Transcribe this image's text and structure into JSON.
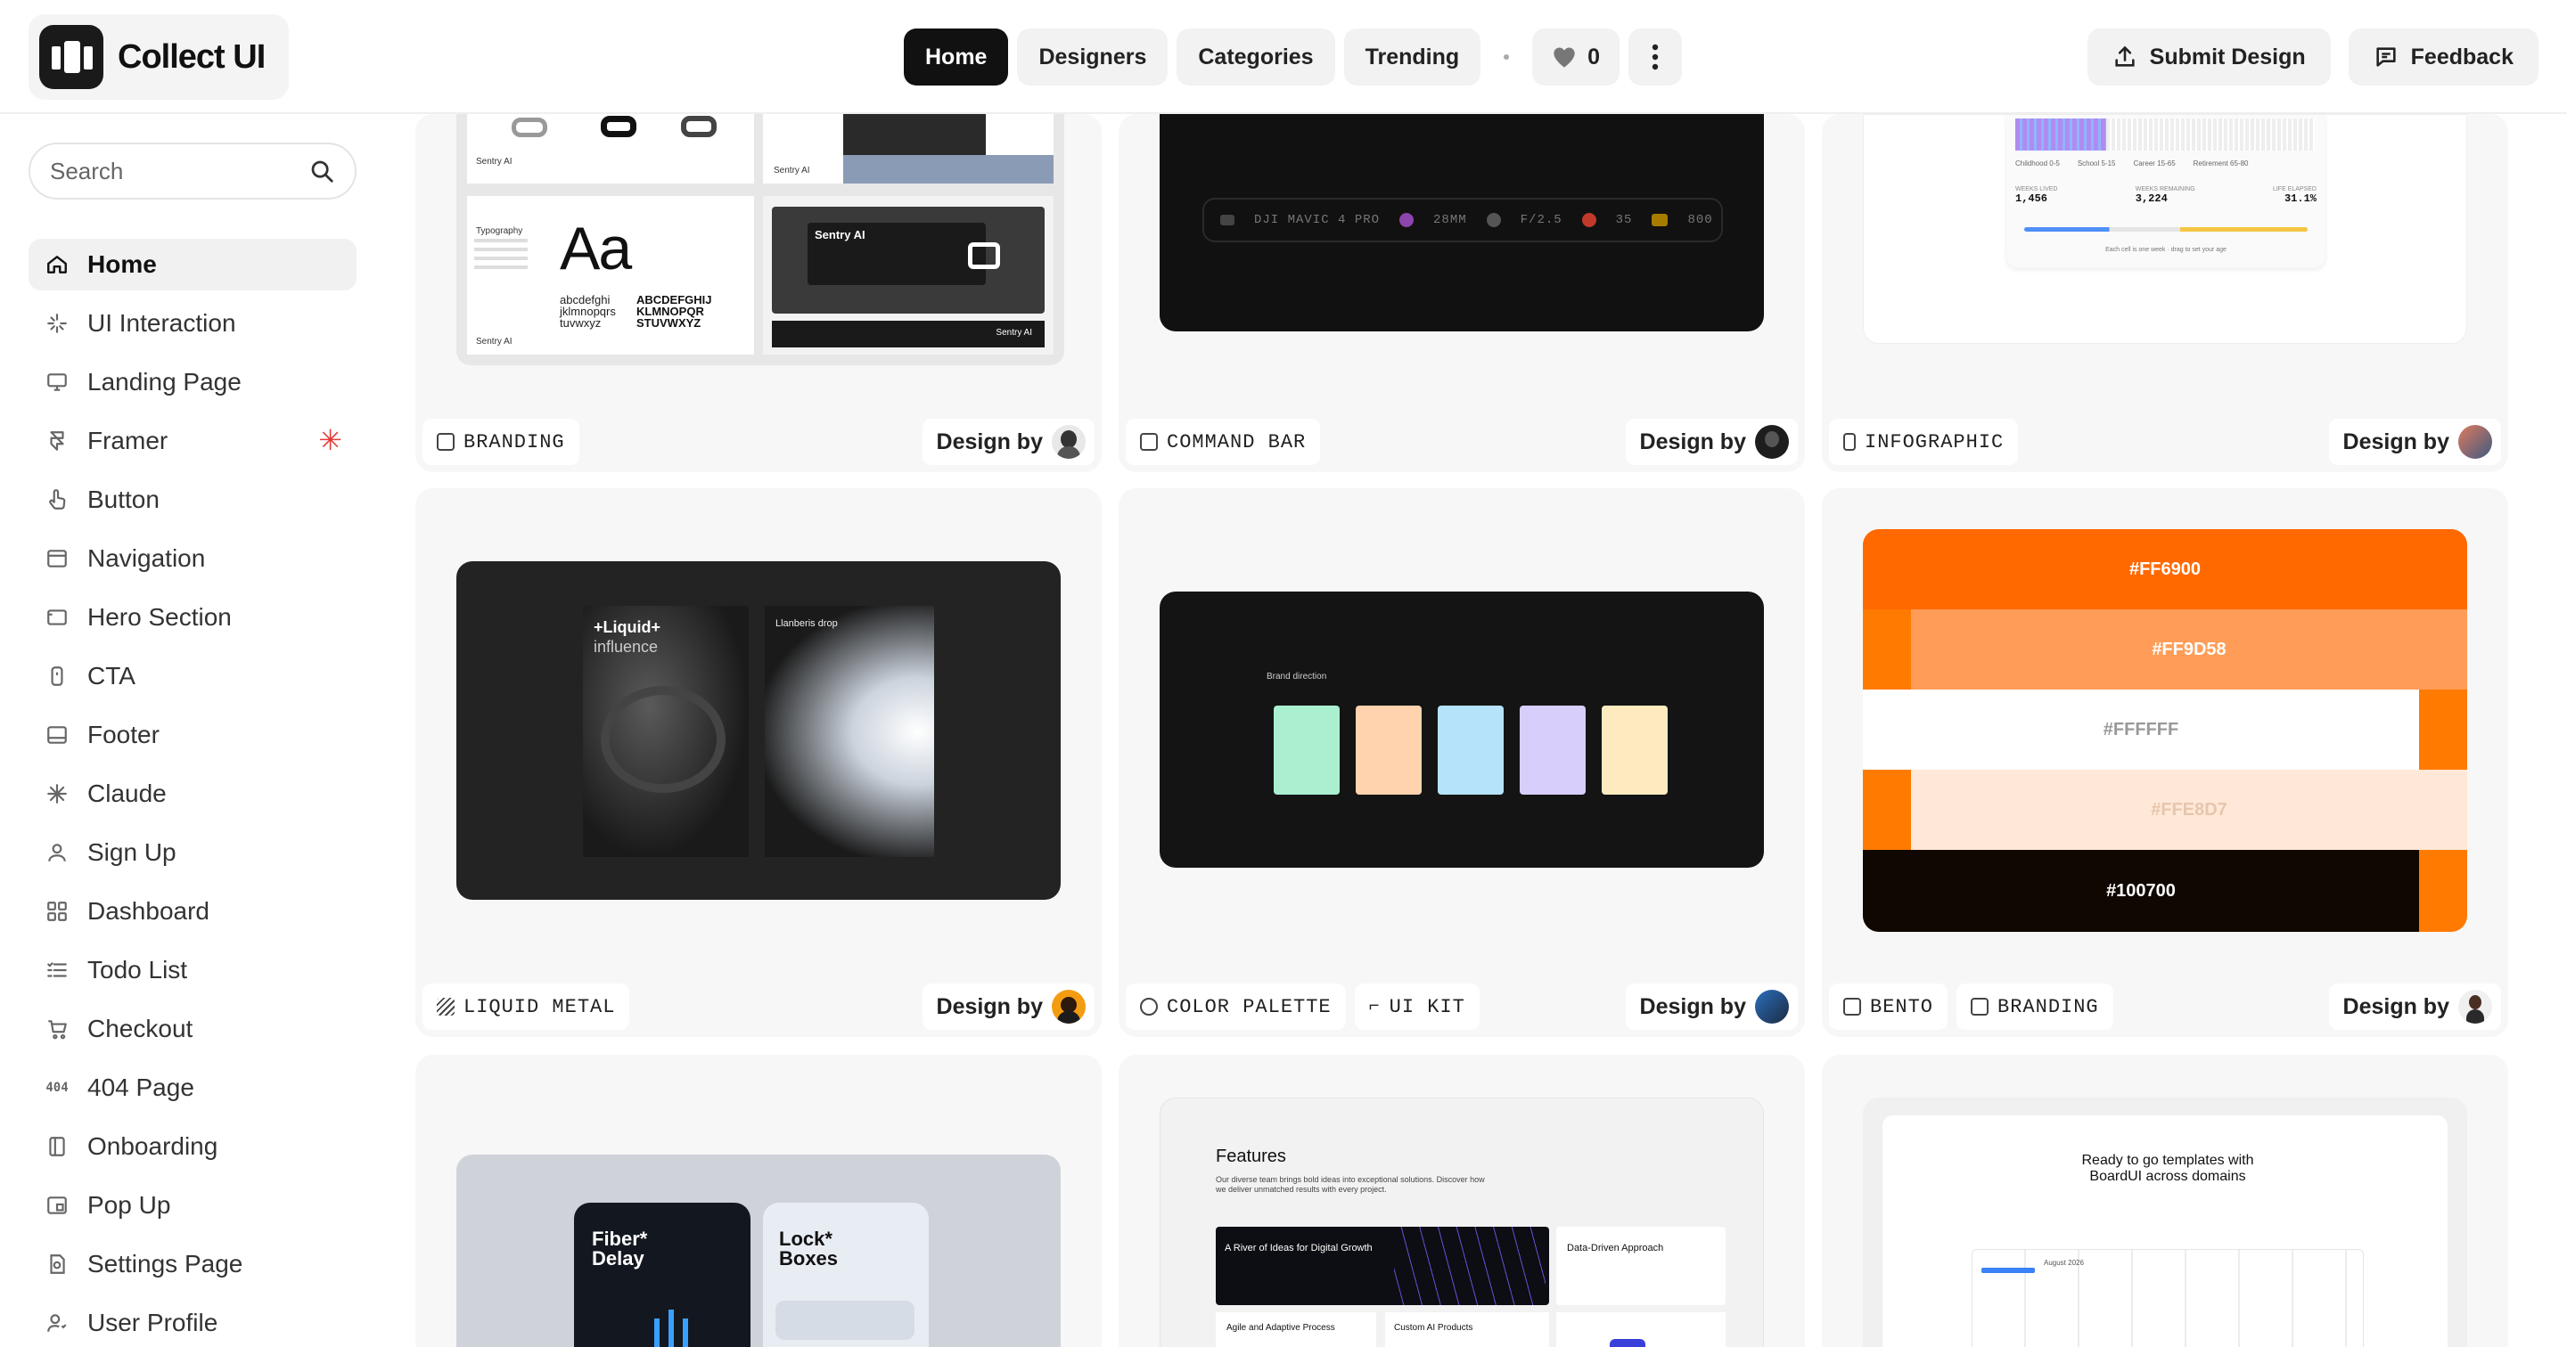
{
  "app": {
    "name": "Collect UI"
  },
  "nav": {
    "home": "Home",
    "designers": "Designers",
    "categories": "Categories",
    "trending": "Trending",
    "likes_count": "0"
  },
  "header_actions": {
    "submit": "Submit Design",
    "feedback": "Feedback"
  },
  "search": {
    "placeholder": "Search"
  },
  "sidebar": {
    "items": [
      {
        "label": "Home",
        "icon": "home-icon"
      },
      {
        "label": "UI Interaction",
        "icon": "sparkle-icon"
      },
      {
        "label": "Landing Page",
        "icon": "monitor-icon"
      },
      {
        "label": "Framer",
        "icon": "framer-icon"
      },
      {
        "label": "Button",
        "icon": "pointer-icon"
      },
      {
        "label": "Navigation",
        "icon": "navigation-icon"
      },
      {
        "label": "Hero Section",
        "icon": "hero-icon"
      },
      {
        "label": "CTA",
        "icon": "cta-icon"
      },
      {
        "label": "Footer",
        "icon": "footer-icon"
      },
      {
        "label": "Claude",
        "icon": "claude-icon"
      },
      {
        "label": "Sign Up",
        "icon": "user-icon"
      },
      {
        "label": "Dashboard",
        "icon": "dashboard-icon"
      },
      {
        "label": "Todo List",
        "icon": "list-icon"
      },
      {
        "label": "Checkout",
        "icon": "cart-icon"
      },
      {
        "label": "404 Page",
        "icon": "404-icon"
      },
      {
        "label": "Onboarding",
        "icon": "book-icon"
      },
      {
        "label": "Pop Up",
        "icon": "popup-icon"
      },
      {
        "label": "Settings Page",
        "icon": "settings-icon"
      },
      {
        "label": "User Profile",
        "icon": "user-profile-icon"
      }
    ]
  },
  "cards": {
    "design_by": "Design by",
    "row1": [
      {
        "tags": [
          "BRANDING"
        ]
      },
      {
        "tags": [
          "COMMAND BAR"
        ]
      },
      {
        "tags": [
          "INFOGRAPHIC"
        ]
      }
    ],
    "row2": [
      {
        "tags": [
          "LIQUID METAL"
        ]
      },
      {
        "tags": [
          "COLOR PALETTE",
          "UI KIT"
        ]
      },
      {
        "tags": [
          "BENTO",
          "BRANDING"
        ]
      }
    ]
  },
  "thumbs": {
    "branding": {
      "typography": "Typography",
      "aa": "Aa",
      "lower": "abcdefghi jklmnopqrs tuvwxyz",
      "upper": "ABCDEFGHIJ KLMNOPQR STUVWXYZ",
      "brand": "Sentry AI"
    },
    "command_bar": {
      "items": [
        "DJI MAVIC 4 PRO",
        "28MM",
        "F/2.5",
        "35",
        "800"
      ]
    },
    "infographic": {
      "legend": [
        "Childhood 0-5",
        "School 5-15",
        "Career 15-65",
        "Retirement 65-80"
      ],
      "stats": [
        {
          "label": "WEEKS LIVED",
          "value": "1,456"
        },
        {
          "label": "WEEKS REMAINING",
          "value": "3,224"
        },
        {
          "label": "LIFE ELAPSED",
          "value": "31.1%"
        }
      ],
      "caption": "Each cell is one week · drag to set your age"
    },
    "liquid": {
      "title": "+Liquid+",
      "subtitle": "influence",
      "drop": "Llanberis drop"
    },
    "palette": {
      "title": "Brand direction",
      "colors": [
        "#A9EFD0",
        "#FFD3AE",
        "#B5E3FA",
        "#D8CEFB",
        "#FDEBBF"
      ]
    },
    "bento": {
      "swatches": [
        "#FF6900",
        "#FF9D58",
        "#FFFFFF",
        "#FFE8D7",
        "#100700"
      ]
    },
    "fiber": {
      "a": "Fiber* Delay",
      "b": "Lock* Boxes"
    },
    "features": {
      "title": "Features",
      "desc": "Our diverse team brings bold ideas into exceptional solutions. Discover how we deliver unmatched results with every project.",
      "river": "A River of Ideas for Digital Growth",
      "data": "Data-Driven Approach",
      "agile": "Agile and Adaptive Process",
      "custom": "Custom AI Products"
    },
    "board": {
      "title": "Ready to go templates with BoardUI across domains",
      "month": "August 2026"
    }
  },
  "colors": {
    "accent_red": "#e53935",
    "orange": "#FF7A00"
  }
}
